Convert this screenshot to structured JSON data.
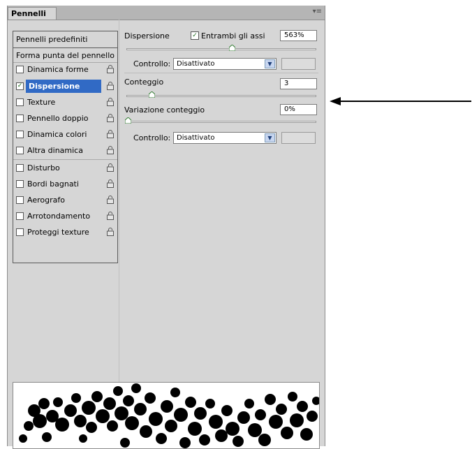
{
  "panel": {
    "tab_label": "Pennelli",
    "menu_icon": "panel-menu-icon",
    "menu_glyph": "▾≡"
  },
  "left": {
    "preset_label": "Pennelli predefiniti",
    "tip_shape_label": "Forma punta del pennello",
    "items": [
      {
        "label": "Dinamica forme",
        "checked": false,
        "selected": false
      },
      {
        "label": "Dispersione",
        "checked": true,
        "selected": true
      },
      {
        "label": "Texture",
        "checked": false,
        "selected": false
      },
      {
        "label": "Pennello doppio",
        "checked": false,
        "selected": false
      },
      {
        "label": "Dinamica colori",
        "checked": false,
        "selected": false
      },
      {
        "label": "Altra dinamica",
        "checked": false,
        "selected": false
      },
      {
        "label": "Disturbo",
        "checked": false,
        "selected": false
      },
      {
        "label": "Bordi bagnati",
        "checked": false,
        "selected": false
      },
      {
        "label": "Aerografo",
        "checked": false,
        "selected": false
      },
      {
        "label": "Arrotondamento",
        "checked": false,
        "selected": false
      },
      {
        "label": "Proteggi texture",
        "checked": false,
        "selected": false
      }
    ],
    "check_glyph": "✓"
  },
  "right": {
    "scatter": {
      "label": "Dispersione",
      "both_axes_label": "Entrambi gli assi",
      "both_axes_checked": true,
      "value": "563%",
      "slider_fraction": 0.56
    },
    "control1": {
      "label": "Controllo:",
      "selected": "Disattivato"
    },
    "count": {
      "label": "Conteggio",
      "value": "3",
      "slider_fraction": 0.12
    },
    "count_jitter": {
      "label": "Variazione conteggio",
      "value": "0%",
      "slider_fraction": 0.0
    },
    "control2": {
      "label": "Controllo:",
      "selected": "Disattivato"
    },
    "dropdown_glyph": "▼"
  },
  "colors": {
    "panel_bg": "#d6d6d6",
    "selection": "#316ac5"
  }
}
